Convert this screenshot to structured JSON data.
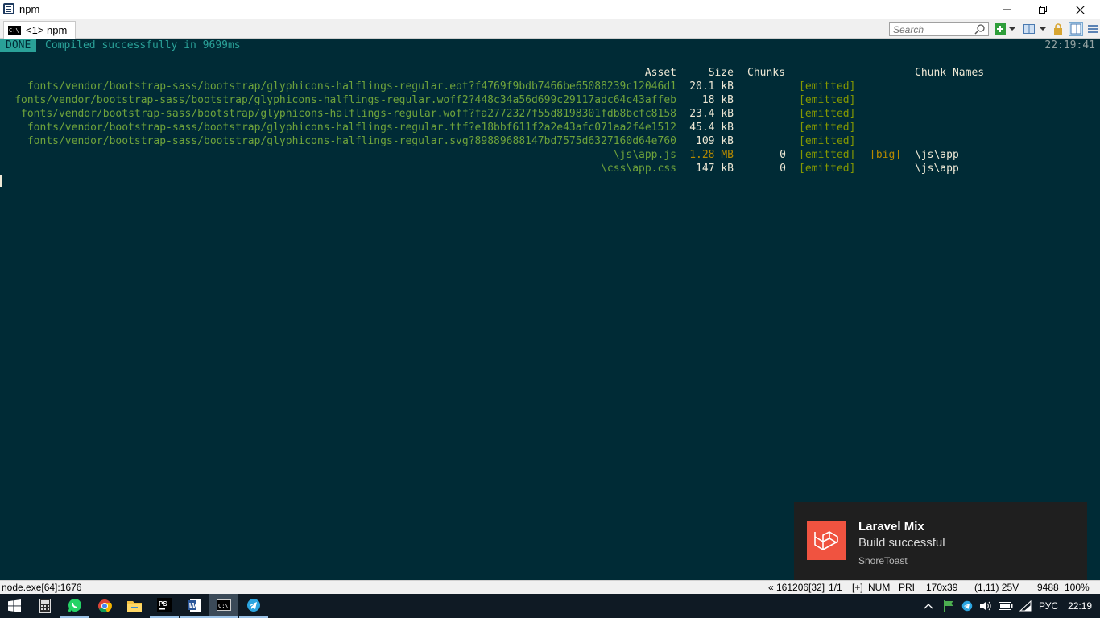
{
  "window": {
    "title": "npm"
  },
  "tab": {
    "label": "<1> npm",
    "icon": "cmd-icon"
  },
  "toolbar": {
    "search_placeholder": "Search"
  },
  "terminal": {
    "done_label": "DONE",
    "done_message": "Compiled successfully in 9699ms",
    "time": "22:19:41",
    "headers": {
      "asset": "Asset",
      "size": "Size",
      "chunks": "Chunks",
      "chunk_names": "Chunk Names"
    },
    "rows": [
      {
        "asset": "fonts/vendor/bootstrap-sass/bootstrap/glyphicons-halflings-regular.eot?f4769f9bdb7466be65088239c12046d1",
        "size": "20.1 kB",
        "chunks": "",
        "emitted": "[emitted]",
        "big": "",
        "names": ""
      },
      {
        "asset": "fonts/vendor/bootstrap-sass/bootstrap/glyphicons-halflings-regular.woff2?448c34a56d699c29117adc64c43affeb",
        "size": "18 kB",
        "chunks": "",
        "emitted": "[emitted]",
        "big": "",
        "names": ""
      },
      {
        "asset": "fonts/vendor/bootstrap-sass/bootstrap/glyphicons-halflings-regular.woff?fa2772327f55d8198301fdb8bcfc8158",
        "size": "23.4 kB",
        "chunks": "",
        "emitted": "[emitted]",
        "big": "",
        "names": ""
      },
      {
        "asset": "fonts/vendor/bootstrap-sass/bootstrap/glyphicons-halflings-regular.ttf?e18bbf611f2a2e43afc071aa2f4e1512",
        "size": "45.4 kB",
        "chunks": "",
        "emitted": "[emitted]",
        "big": "",
        "names": ""
      },
      {
        "asset": "fonts/vendor/bootstrap-sass/bootstrap/glyphicons-halflings-regular.svg?89889688147bd7575d6327160d64e760",
        "size": "109 kB",
        "chunks": "",
        "emitted": "[emitted]",
        "big": "",
        "names": ""
      },
      {
        "asset": "\\js\\app.js",
        "size": "1.28 MB",
        "chunks": "0",
        "emitted": "[emitted]",
        "big": "[big]",
        "names": "\\js\\app"
      },
      {
        "asset": "\\css\\app.css",
        "size": "147 kB",
        "chunks": "0",
        "emitted": "[emitted]",
        "big": "",
        "names": "\\js\\app"
      }
    ]
  },
  "notification": {
    "title": "Laravel Mix",
    "body": "Build successful",
    "source": "SnoreToast",
    "icon": "laravel-logo-icon"
  },
  "statusbar": {
    "process": "node.exe[64]:1676",
    "position": "« 161206[32]",
    "page": "1/1",
    "plus": "[+]",
    "num": "NUM",
    "pri": "PRI",
    "size": "170x39",
    "cursor": "(1,11) 25V",
    "pid": "9488",
    "zoom": "100%"
  },
  "taskbar": {
    "apps": [
      "start-icon",
      "calculator-icon",
      "whatsapp-icon",
      "chrome-icon",
      "file-explorer-icon",
      "phpstorm-icon",
      "word-icon",
      "conemu-icon",
      "telegram-icon"
    ],
    "tray_lang": "РУС",
    "tray_time": "22:19"
  },
  "colors": {
    "terminal_bg": "#002b36",
    "done_bg": "#2aa198",
    "asset_green": "#859900",
    "warning_yellow": "#b58900",
    "laravel_red": "#f05340"
  }
}
